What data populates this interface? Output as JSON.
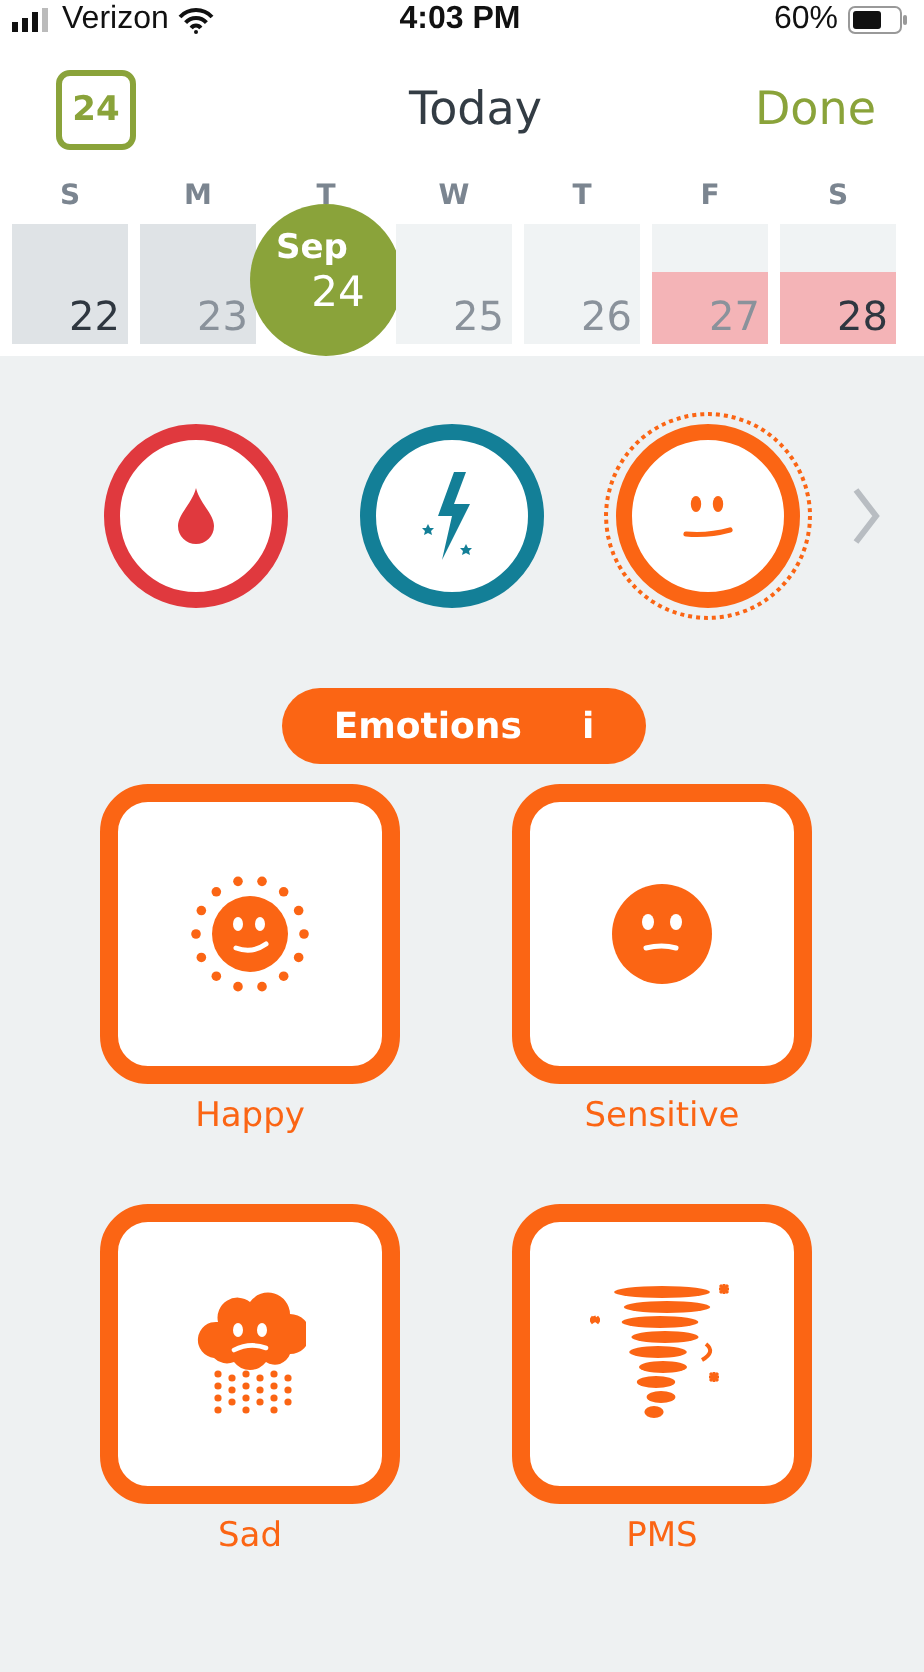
{
  "status_bar": {
    "carrier": "Verizon",
    "time": "4:03 PM",
    "battery": "60%"
  },
  "header": {
    "calendar_day": "24",
    "title": "Today",
    "done": "Done"
  },
  "weekdays": [
    "S",
    "M",
    "T",
    "W",
    "T",
    "F",
    "S"
  ],
  "days": [
    {
      "number": "22",
      "past": true,
      "period": false,
      "weekend": true,
      "selected": false
    },
    {
      "number": "23",
      "past": true,
      "period": false,
      "weekend": false,
      "selected": false
    },
    {
      "number": "24",
      "month": "Sep",
      "selected": true
    },
    {
      "number": "25",
      "past": false,
      "period": false,
      "weekend": false,
      "selected": false
    },
    {
      "number": "26",
      "past": false,
      "period": false,
      "weekend": false,
      "selected": false
    },
    {
      "number": "27",
      "past": false,
      "period": true,
      "weekend": false,
      "selected": false
    },
    {
      "number": "28",
      "past": false,
      "period": true,
      "weekend": true,
      "selected": false
    }
  ],
  "categories": [
    {
      "kind": "bleeding",
      "color": "#e0393e",
      "selected": false
    },
    {
      "kind": "pain",
      "color": "#137f97",
      "selected": false
    },
    {
      "kind": "emotions",
      "color": "#fb6514",
      "selected": true
    }
  ],
  "section": {
    "title": "Emotions",
    "info": "i"
  },
  "options": [
    {
      "kind": "happy",
      "label": "Happy"
    },
    {
      "kind": "sensitive",
      "label": "Sensitive"
    },
    {
      "kind": "sad",
      "label": "Sad"
    },
    {
      "kind": "pms",
      "label": "PMS"
    }
  ]
}
